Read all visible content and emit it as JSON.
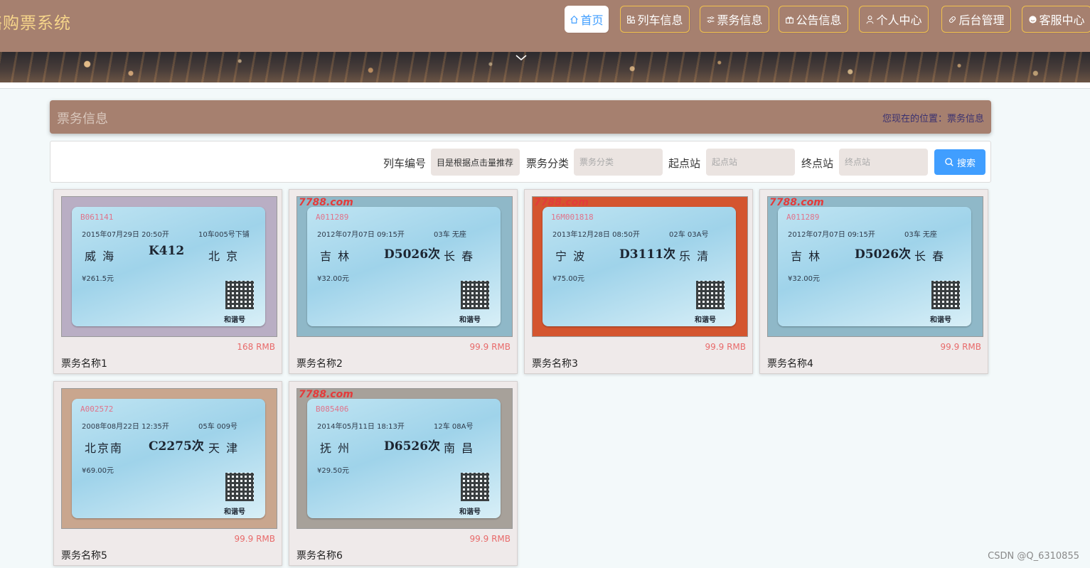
{
  "header": {
    "site_title": "络购票系统",
    "nav": [
      {
        "label": "首页",
        "icon": "home-icon",
        "active": true
      },
      {
        "label": "列车信息",
        "icon": "grid-icon",
        "active": false
      },
      {
        "label": "票务信息",
        "icon": "sliders-icon",
        "active": false
      },
      {
        "label": "公告信息",
        "icon": "gift-icon",
        "active": false
      },
      {
        "label": "个人中心",
        "icon": "user-icon",
        "active": false
      },
      {
        "label": "后台管理",
        "icon": "link-icon",
        "active": false
      },
      {
        "label": "客服中心",
        "icon": "chat-icon",
        "active": false
      }
    ]
  },
  "section": {
    "title": "票务信息",
    "breadcrumb": "您现在的位置：票务信息"
  },
  "search": {
    "fields": [
      {
        "label": "列车编号",
        "value": "目是根据点击量推荐",
        "placeholder": ""
      },
      {
        "label": "票务分类",
        "value": "",
        "placeholder": "票务分类"
      },
      {
        "label": "起点站",
        "value": "",
        "placeholder": "起点站"
      },
      {
        "label": "终点站",
        "value": "",
        "placeholder": "终点站"
      }
    ],
    "button_label": "搜索"
  },
  "cards": [
    {
      "name": "票务名称1",
      "price": "168 RMB",
      "ticket": {
        "serial": "B061141",
        "from": "威 海",
        "to": "北 京",
        "train": "K412",
        "date": "2015年07月29日 20:50开",
        "price": "¥261.5元",
        "seat": "10车005号下铺"
      },
      "watermark": "",
      "bg": "#b9aec4"
    },
    {
      "name": "票务名称2",
      "price": "99.9 RMB",
      "ticket": {
        "serial": "A011289",
        "from": "吉 林",
        "to": "长 春",
        "train": "D5026次",
        "date": "2012年07月07日 09:15开",
        "price": "¥32.00元",
        "seat": "03车 无座"
      },
      "watermark": "7788.com",
      "bg": "#8fb8c8"
    },
    {
      "name": "票务名称3",
      "price": "99.9 RMB",
      "ticket": {
        "serial": "16M001818",
        "from": "宁 波",
        "to": "乐 清",
        "train": "D3111次",
        "date": "2013年12月28日 08:50开",
        "price": "¥75.00元",
        "seat": "02车 03A号"
      },
      "watermark": "7788.com",
      "bg": "#d4552f"
    },
    {
      "name": "票务名称4",
      "price": "99.9 RMB",
      "ticket": {
        "serial": "A011289",
        "from": "吉 林",
        "to": "长 春",
        "train": "D5026次",
        "date": "2012年07月07日 09:15开",
        "price": "¥32.00元",
        "seat": "03车 无座"
      },
      "watermark": "7788.com",
      "bg": "#8fb8c8"
    },
    {
      "name": "票务名称5",
      "price": "99.9 RMB",
      "ticket": {
        "serial": "A002572",
        "from": "北京南",
        "to": "天 津",
        "train": "C2275次",
        "date": "2008年08月22日 12:35开",
        "price": "¥69.00元",
        "seat": "05车 009号"
      },
      "watermark": "",
      "bg": "#c9a68e"
    },
    {
      "name": "票务名称6",
      "price": "99.9 RMB",
      "ticket": {
        "serial": "B085406",
        "from": "抚 州",
        "to": "南 昌",
        "train": "D6526次",
        "date": "2014年05月11日 18:13开",
        "price": "¥29.50元",
        "seat": "12车 08A号"
      },
      "watermark": "7788.com",
      "bg": "#a7a19a"
    }
  ],
  "footer": {
    "watermark": "CSDN @Q_6310855"
  }
}
